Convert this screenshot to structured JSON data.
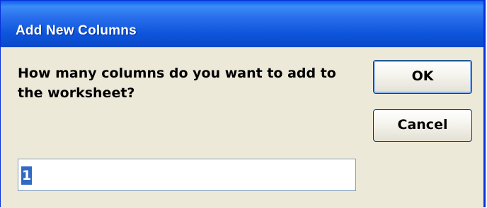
{
  "window": {
    "title": "Add New Columns"
  },
  "dialog": {
    "prompt": "How many columns do you want to add to the worksheet?",
    "ok_label": "OK",
    "cancel_label": "Cancel",
    "input_value": "1"
  },
  "colors": {
    "titlebar": "#0a5fe8",
    "dialog_background": "#ece9d8",
    "selection": "#316ac5"
  }
}
